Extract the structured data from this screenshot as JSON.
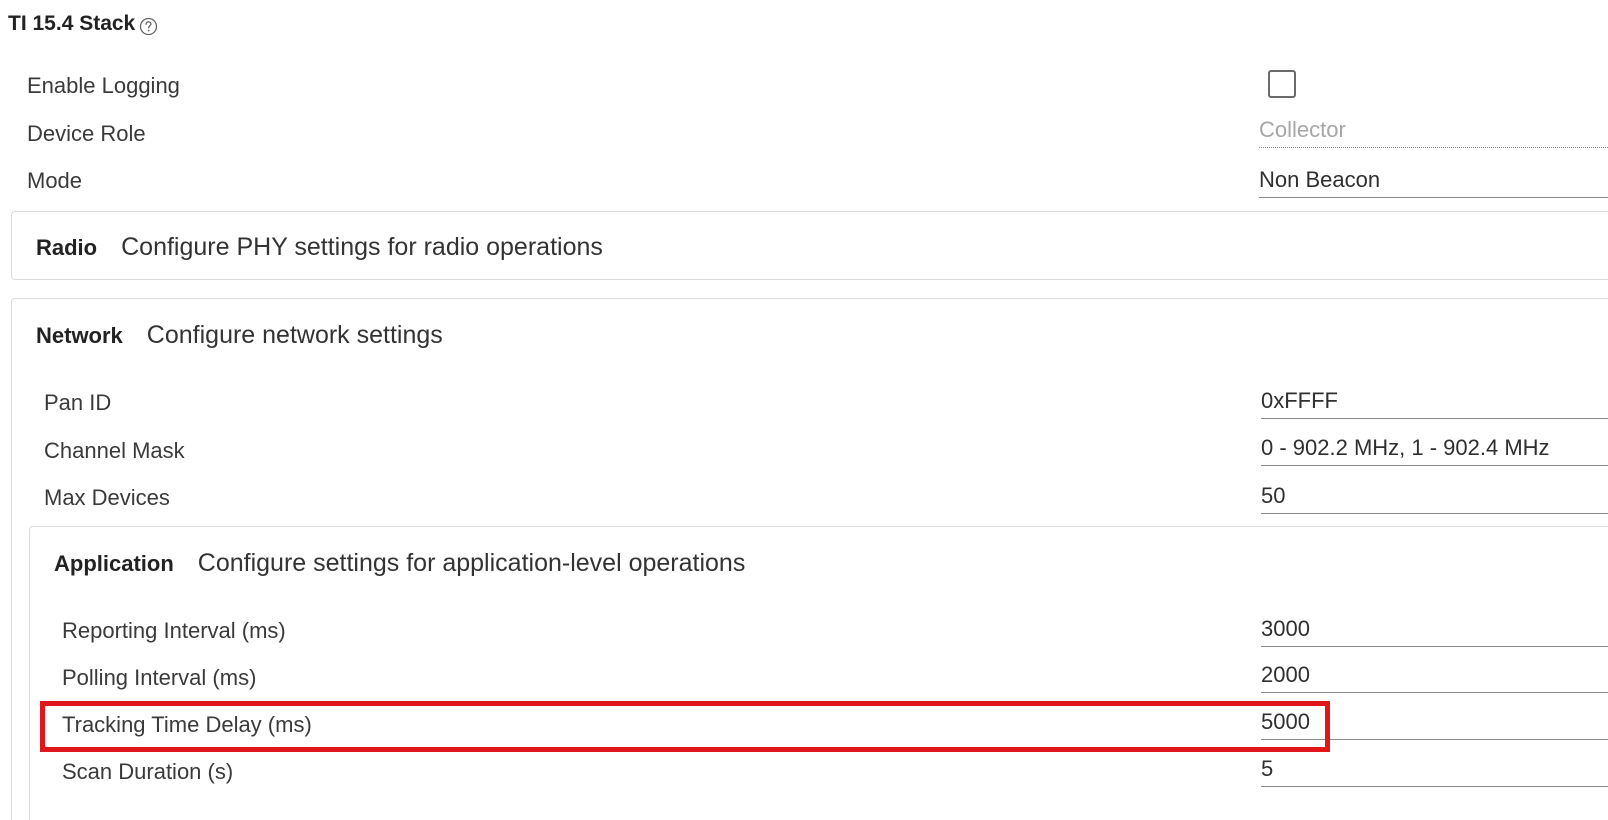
{
  "title": "TI 15.4 Stack",
  "help_icon": "question-circle-icon",
  "top_settings": {
    "enable_logging_label": "Enable Logging",
    "enable_logging_checked": false,
    "device_role_label": "Device Role",
    "device_role_value": "Collector",
    "mode_label": "Mode",
    "mode_value": "Non Beacon"
  },
  "radio": {
    "name": "Radio",
    "description": "Configure PHY settings for radio operations"
  },
  "network": {
    "name": "Network",
    "description": "Configure network settings",
    "pan_id_label": "Pan ID",
    "pan_id_value": "0xFFFF",
    "channel_mask_label": "Channel Mask",
    "channel_mask_value": "0 - 902.2 MHz, 1 - 902.4 MHz",
    "max_devices_label": "Max Devices",
    "max_devices_value": "50"
  },
  "application": {
    "name": "Application",
    "description": "Configure settings for application-level operations",
    "reporting_label": "Reporting Interval (ms)",
    "reporting_value": "3000",
    "polling_label": "Polling Interval (ms)",
    "polling_value": "2000",
    "tracking_label": "Tracking Time Delay (ms)",
    "tracking_value": "5000",
    "scan_label": "Scan Duration (s)",
    "scan_value": "5"
  },
  "colors": {
    "highlight": "#e0161b",
    "border": "#dcdcdc"
  }
}
